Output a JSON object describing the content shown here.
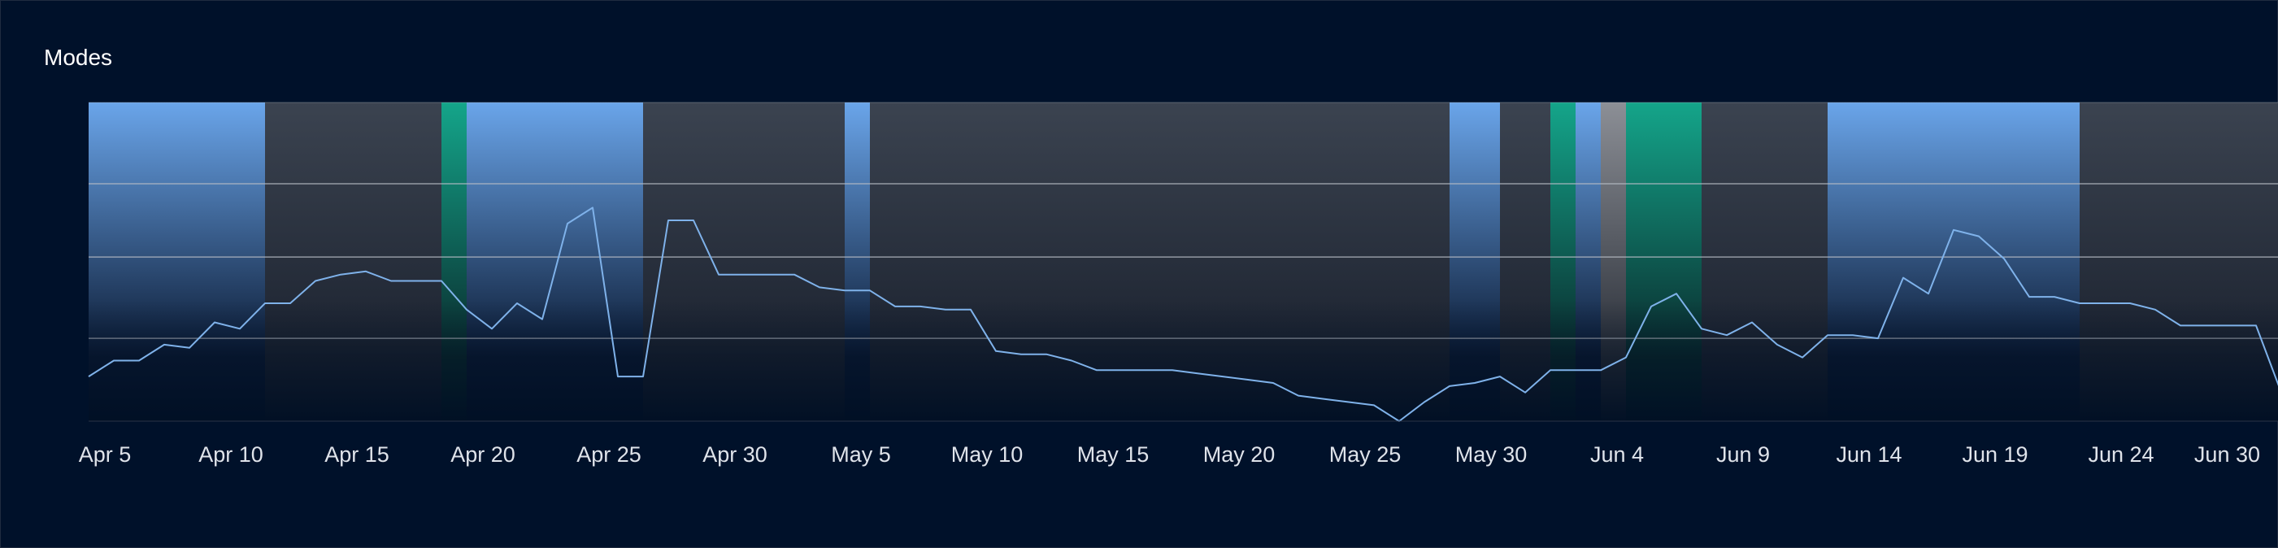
{
  "panel": {
    "title": "Modes"
  },
  "chart_data": {
    "type": "line",
    "title": "Modes",
    "xlabel": "",
    "ylabel": "",
    "x_start": "Apr 5",
    "x_end": "Jul 1",
    "x_ticks": [
      "Apr 5",
      "Apr 10",
      "Apr 15",
      "Apr 20",
      "Apr 25",
      "Apr 30",
      "May 5",
      "May 10",
      "May 15",
      "May 20",
      "May 25",
      "May 30",
      "Jun 4",
      "Jun 9",
      "Jun 14",
      "Jun 19",
      "Jun 24",
      "Jun 30"
    ],
    "ylim": [
      0,
      100
    ],
    "grid": "horizontal",
    "mode_bands": [
      {
        "start": "Apr 5",
        "end": "Apr 12",
        "mode": "blue"
      },
      {
        "start": "Apr 12",
        "end": "Apr 19",
        "mode": "gray"
      },
      {
        "start": "Apr 19",
        "end": "Apr 20",
        "mode": "green"
      },
      {
        "start": "Apr 20",
        "end": "Apr 27",
        "mode": "blue"
      },
      {
        "start": "Apr 27",
        "end": "May 5",
        "mode": "gray"
      },
      {
        "start": "May 5",
        "end": "May 6",
        "mode": "blue"
      },
      {
        "start": "May 6",
        "end": "May 29",
        "mode": "gray"
      },
      {
        "start": "May 29",
        "end": "May 31",
        "mode": "blue"
      },
      {
        "start": "May 31",
        "end": "Jun 2",
        "mode": "gray"
      },
      {
        "start": "Jun 2",
        "end": "Jun 3",
        "mode": "green"
      },
      {
        "start": "Jun 3",
        "end": "Jun 4",
        "mode": "blue"
      },
      {
        "start": "Jun 4",
        "end": "Jun 5",
        "mode": "lightgray"
      },
      {
        "start": "Jun 5",
        "end": "Jun 8",
        "mode": "green"
      },
      {
        "start": "Jun 8",
        "end": "Jun 13",
        "mode": "gray"
      },
      {
        "start": "Jun 13",
        "end": "Jun 23",
        "mode": "blue"
      },
      {
        "start": "Jun 23",
        "end": "Jul 1",
        "mode": "gray"
      }
    ],
    "series": [
      {
        "color": "#7fb2ea",
        "points": [
          [
            "Apr 5",
            14
          ],
          [
            "Apr 6",
            19
          ],
          [
            "Apr 7",
            19
          ],
          [
            "Apr 8",
            24
          ],
          [
            "Apr 9",
            23
          ],
          [
            "Apr 10",
            31
          ],
          [
            "Apr 11",
            29
          ],
          [
            "Apr 12",
            37
          ],
          [
            "Apr 13",
            37
          ],
          [
            "Apr 14",
            44
          ],
          [
            "Apr 15",
            46
          ],
          [
            "Apr 16",
            47
          ],
          [
            "Apr 17",
            44
          ],
          [
            "Apr 18",
            44
          ],
          [
            "Apr 19",
            44
          ],
          [
            "Apr 20",
            35
          ],
          [
            "Apr 21",
            29
          ],
          [
            "Apr 22",
            37
          ],
          [
            "Apr 23",
            32
          ],
          [
            "Apr 24",
            62
          ],
          [
            "Apr 25",
            67
          ],
          [
            "Apr 26",
            14
          ],
          [
            "Apr 27",
            14
          ],
          [
            "Apr 28",
            63
          ],
          [
            "Apr 29",
            63
          ],
          [
            "Apr 30",
            46
          ],
          [
            "May 1",
            46
          ],
          [
            "May 2",
            46
          ],
          [
            "May 3",
            46
          ],
          [
            "May 4",
            42
          ],
          [
            "May 5",
            41
          ],
          [
            "May 6",
            41
          ],
          [
            "May 7",
            36
          ],
          [
            "May 8",
            36
          ],
          [
            "May 9",
            35
          ],
          [
            "May 10",
            35
          ],
          [
            "May 11",
            22
          ],
          [
            "May 12",
            21
          ],
          [
            "May 13",
            21
          ],
          [
            "May 14",
            19
          ],
          [
            "May 15",
            16
          ],
          [
            "May 16",
            16
          ],
          [
            "May 17",
            16
          ],
          [
            "May 18",
            16
          ],
          [
            "May 19",
            15
          ],
          [
            "May 20",
            14
          ],
          [
            "May 21",
            13
          ],
          [
            "May 22",
            12
          ],
          [
            "May 23",
            8
          ],
          [
            "May 24",
            7
          ],
          [
            "May 25",
            6
          ],
          [
            "May 26",
            5
          ],
          [
            "May 27",
            0
          ],
          [
            "May 28",
            6
          ],
          [
            "May 29",
            11
          ],
          [
            "May 30",
            12
          ],
          [
            "May 31",
            14
          ],
          [
            "Jun 1",
            9
          ],
          [
            "Jun 2",
            16
          ],
          [
            "Jun 3",
            16
          ],
          [
            "Jun 4",
            16
          ],
          [
            "Jun 5",
            20
          ],
          [
            "Jun 6",
            36
          ],
          [
            "Jun 7",
            40
          ],
          [
            "Jun 8",
            29
          ],
          [
            "Jun 9",
            27
          ],
          [
            "Jun 10",
            31
          ],
          [
            "Jun 11",
            24
          ],
          [
            "Jun 12",
            20
          ],
          [
            "Jun 13",
            27
          ],
          [
            "Jun 14",
            27
          ],
          [
            "Jun 15",
            26
          ],
          [
            "Jun 16",
            45
          ],
          [
            "Jun 17",
            40
          ],
          [
            "Jun 18",
            60
          ],
          [
            "Jun 19",
            58
          ],
          [
            "Jun 20",
            51
          ],
          [
            "Jun 21",
            39
          ],
          [
            "Jun 22",
            39
          ],
          [
            "Jun 23",
            37
          ],
          [
            "Jun 24",
            37
          ],
          [
            "Jun 25",
            37
          ],
          [
            "Jun 26",
            35
          ],
          [
            "Jun 27",
            30
          ],
          [
            "Jun 28",
            30
          ],
          [
            "Jun 29",
            30
          ],
          [
            "Jun 30",
            30
          ],
          [
            "Jul 1",
            9
          ]
        ]
      }
    ]
  },
  "colors": {
    "background": "#000f24",
    "plot_gray": "#3b4350",
    "band_blue": "#6aa5ea",
    "band_green": "#14a58a",
    "band_lightgray": "#8c8f96",
    "line": "#7fb2ea",
    "gridline": "#b7bcc4"
  }
}
